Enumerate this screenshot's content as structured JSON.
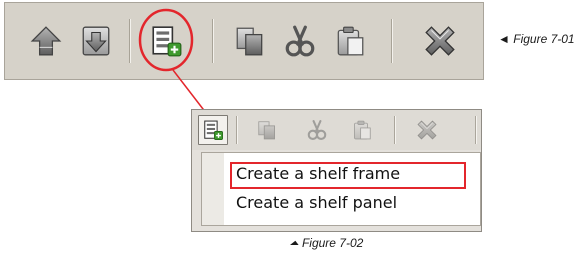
{
  "figure1": {
    "caption": "Figure 7-01",
    "pointer_glyph": "◄",
    "toolbar_icons": [
      "box-up-icon",
      "box-down-icon",
      "create-shelf-icon",
      "copy-icon",
      "cut-icon",
      "paste-icon",
      "delete-icon"
    ]
  },
  "figure2": {
    "caption": "Figure 7-02",
    "pointer_glyph": "⏶",
    "toolbar_icons": [
      "create-shelf-icon",
      "copy-icon",
      "cut-icon",
      "paste-icon",
      "delete-icon"
    ],
    "menu": {
      "items": [
        {
          "label": "Create a shelf frame",
          "highlighted": true
        },
        {
          "label": "Create a shelf panel",
          "highlighted": false
        }
      ]
    }
  },
  "colors": {
    "highlight_red": "#e3262c",
    "toolbar_bg": "#d6d2c9",
    "icon_gray": "#7a7a7a",
    "add_green": "#3f9a2e"
  }
}
